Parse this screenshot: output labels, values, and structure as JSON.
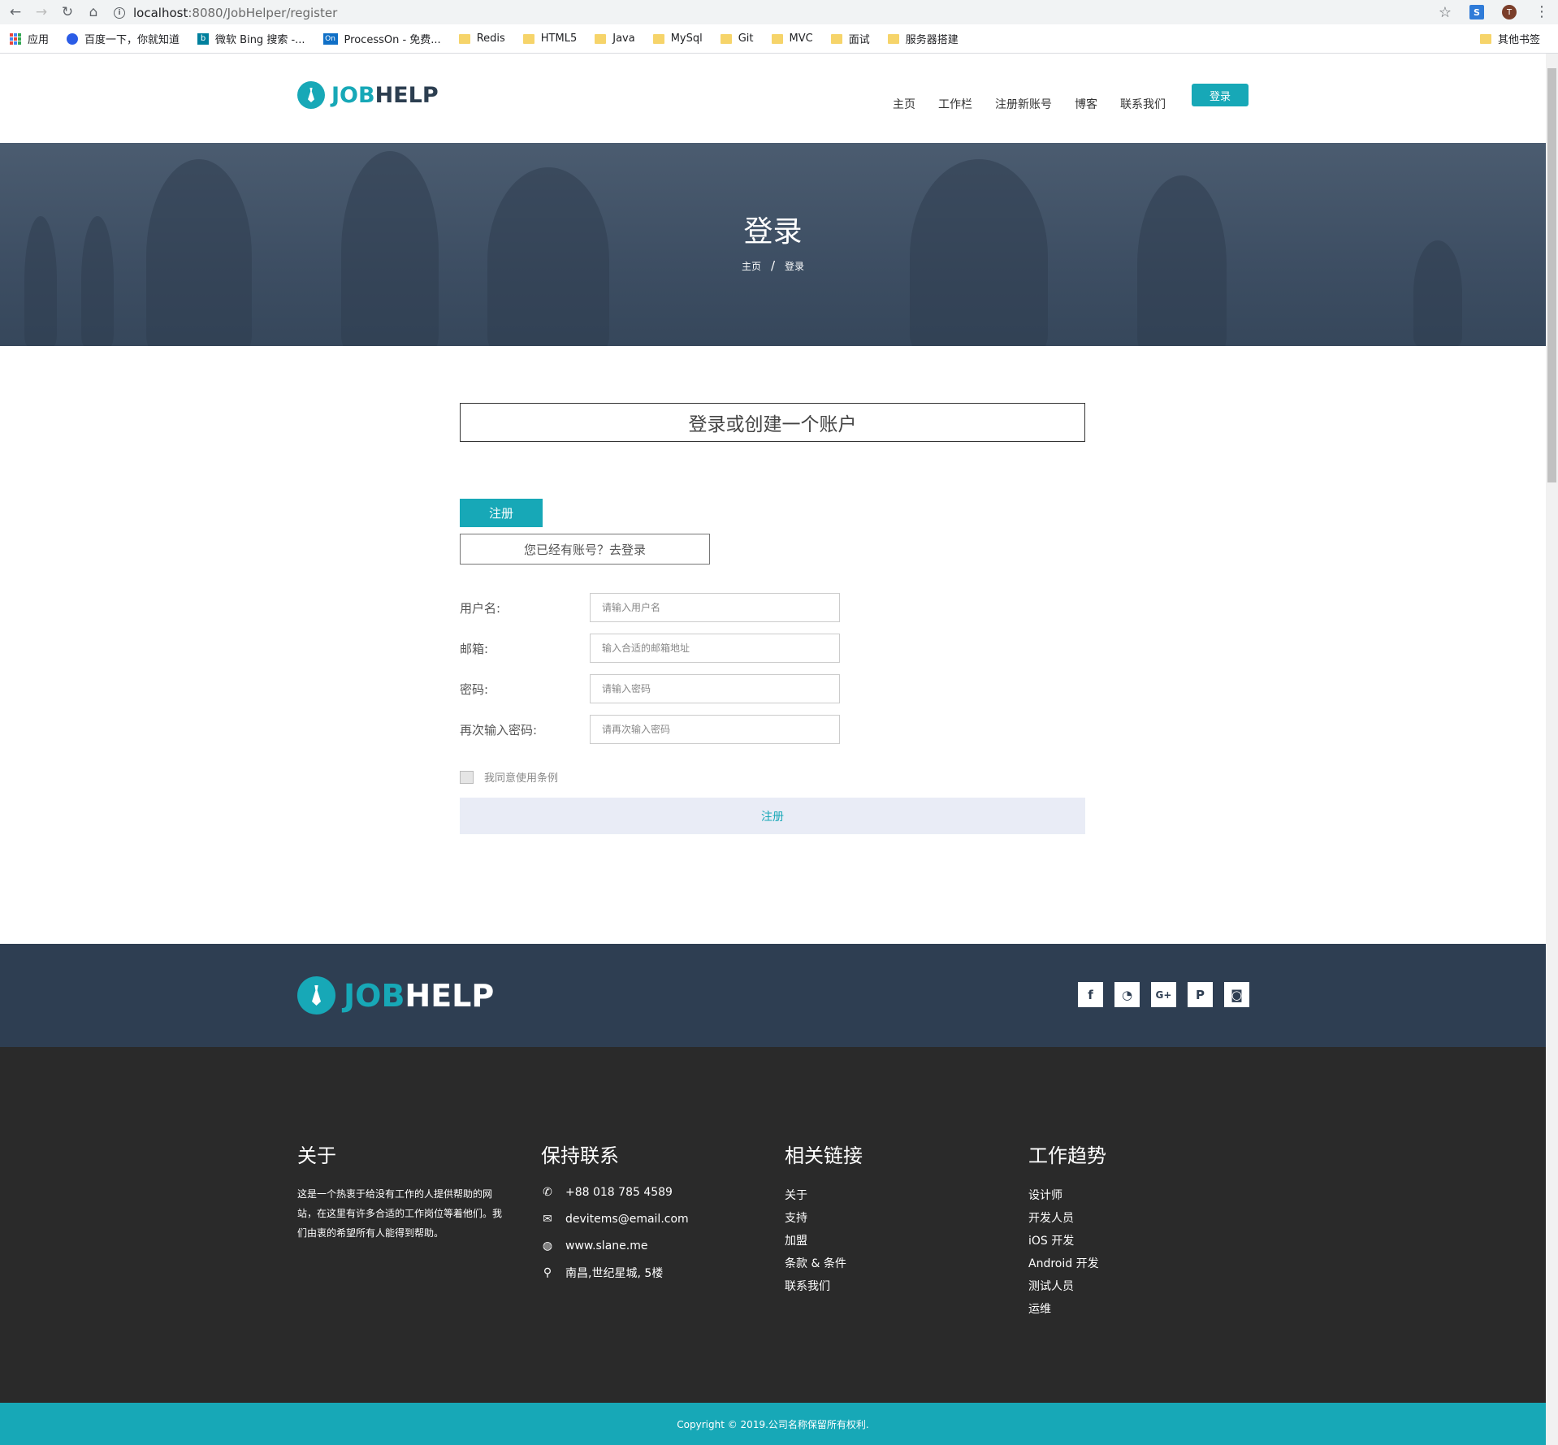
{
  "browser": {
    "url_host": "localhost",
    "url_path": ":8080/JobHelper/register",
    "profile_initial": "T",
    "ext_label": "S",
    "bookmarks": [
      {
        "label": "应用"
      },
      {
        "label": "百度一下，你就知道"
      },
      {
        "label": "微软 Bing 搜索 -..."
      },
      {
        "label": "ProcessOn - 免费..."
      },
      {
        "label": "Redis"
      },
      {
        "label": "HTML5"
      },
      {
        "label": "Java"
      },
      {
        "label": "MySql"
      },
      {
        "label": "Git"
      },
      {
        "label": "MVC"
      },
      {
        "label": "面试"
      },
      {
        "label": "服务器搭建"
      }
    ],
    "other_bookmarks": "其他书签",
    "processon_badge": "On"
  },
  "header": {
    "logo_job": "JOB",
    "logo_help": "HELP",
    "nav": [
      "主页",
      "工作栏",
      "注册新账号",
      "博客",
      "联系我们"
    ],
    "login_button": "登录"
  },
  "hero": {
    "title": "登录",
    "breadcrumb_home": "主页",
    "breadcrumb_sep": "/",
    "breadcrumb_current": "登录"
  },
  "form": {
    "box_title": "登录或创建一个账户",
    "tab_register": "注册",
    "go_login": "您已经有账号？去登录",
    "fields": [
      {
        "label": "用户名:",
        "placeholder": "请输入用户名"
      },
      {
        "label": "邮箱:",
        "placeholder": "输入合适的邮箱地址"
      },
      {
        "label": "密码:",
        "placeholder": "请输入密码"
      },
      {
        "label": "再次输入密码:",
        "placeholder": "请再次输入密码"
      }
    ],
    "terms_label": "我同意使用条例",
    "submit": "注册"
  },
  "footer": {
    "logo_job": "JOB",
    "logo_help": "HELP",
    "socials": [
      "f",
      "rss",
      "G+",
      "P",
      "ig"
    ],
    "about": {
      "title": "关于",
      "text": "这是一个热衷于给没有工作的人提供帮助的网站，在这里有许多合适的工作岗位等着他们。我们由衷的希望所有人能得到帮助。"
    },
    "contact": {
      "title": "保持联系",
      "phone": "+88 018 785 4589",
      "email": "devitems@email.com",
      "website": "www.slane.me",
      "address": "南昌,世纪星城, 5楼"
    },
    "links": {
      "title": "相关链接",
      "items": [
        "关于",
        "支持",
        "加盟",
        "条款 & 条件",
        "联系我们"
      ]
    },
    "trends": {
      "title": "工作趋势",
      "items": [
        "设计师",
        "开发人员",
        "iOS 开发",
        "Android 开发",
        "测试人员",
        "运维"
      ]
    },
    "copyright": "Copyright © 2019.公司名称保留所有权利."
  },
  "colors": {
    "accent": "#17a8b7",
    "brand_dark": "#2c3e50",
    "footer_band": "#2e3e52",
    "footer_dark": "#2a2a2a"
  }
}
